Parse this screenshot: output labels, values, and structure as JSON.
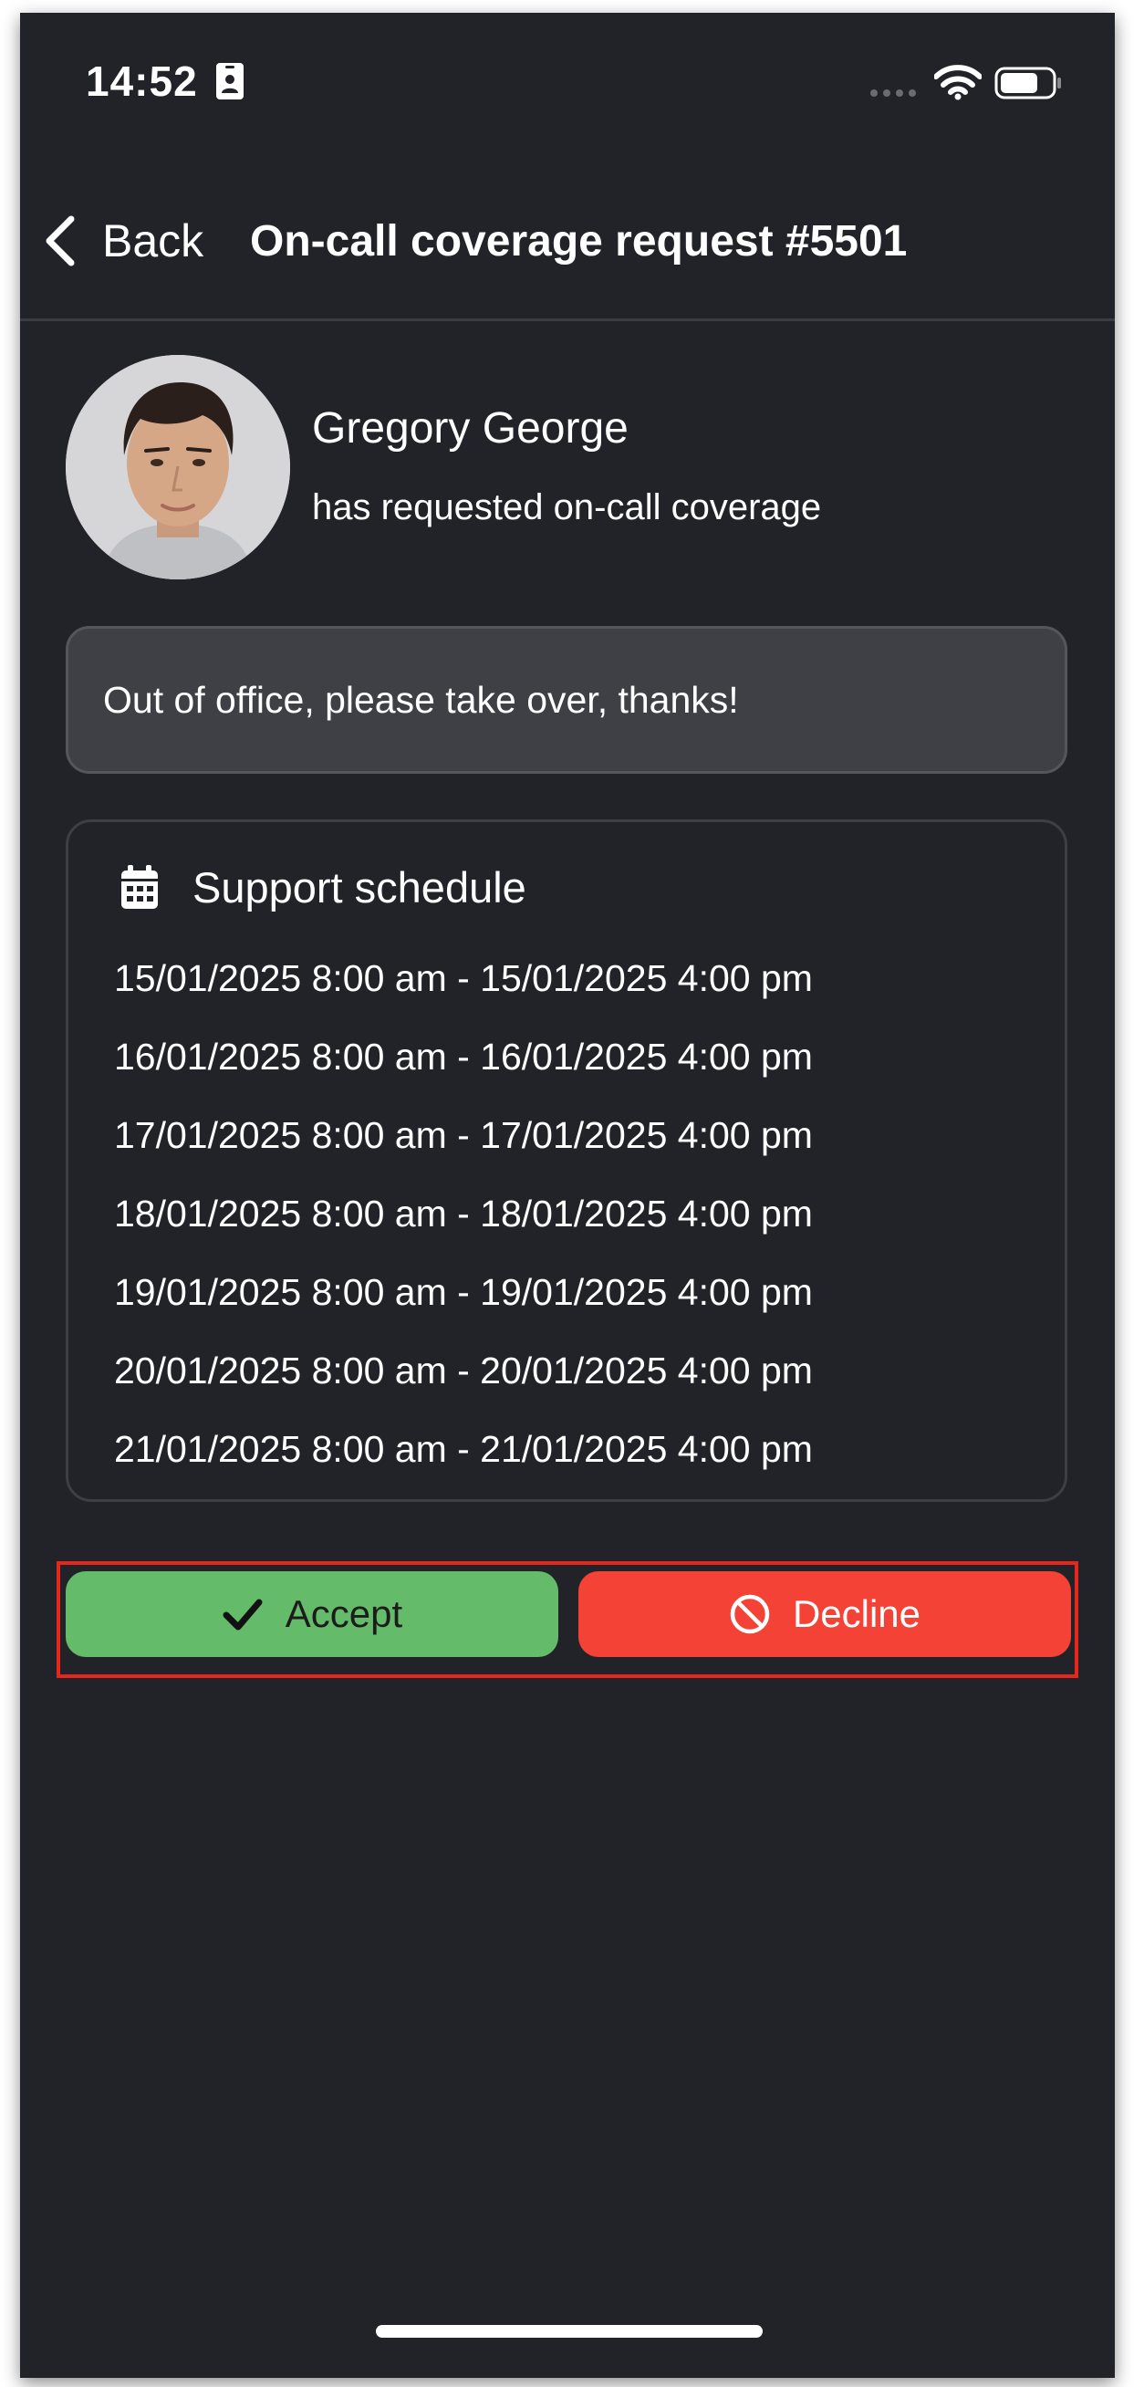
{
  "status_bar": {
    "time": "14:52"
  },
  "nav": {
    "back_label": "Back",
    "title": "On-call coverage request #5501"
  },
  "requester": {
    "name": "Gregory George",
    "subtitle": "has requested on-call coverage"
  },
  "message": "Out of office, please take over, thanks!",
  "schedule": {
    "title": "Support schedule",
    "items": [
      "15/01/2025 8:00 am - 15/01/2025 4:00 pm",
      "16/01/2025 8:00 am - 16/01/2025 4:00 pm",
      "17/01/2025 8:00 am - 17/01/2025 4:00 pm",
      "18/01/2025 8:00 am - 18/01/2025 4:00 pm",
      "19/01/2025 8:00 am - 19/01/2025 4:00 pm",
      "20/01/2025 8:00 am - 20/01/2025 4:00 pm",
      "21/01/2025 8:00 am - 21/01/2025 4:00 pm"
    ]
  },
  "actions": {
    "accept_label": "Accept",
    "decline_label": "Decline"
  },
  "colors": {
    "background": "#222328",
    "accept": "#64bb6a",
    "decline": "#f44336",
    "highlight_frame": "#e8271c"
  },
  "icons": {
    "status": [
      "id-card-icon",
      "cellular-signal-icon",
      "wifi-icon",
      "battery-icon"
    ],
    "back": "chevron-left-icon",
    "schedule": "calendar-icon",
    "accept": "checkmark-icon",
    "decline": "prohibited-icon"
  }
}
